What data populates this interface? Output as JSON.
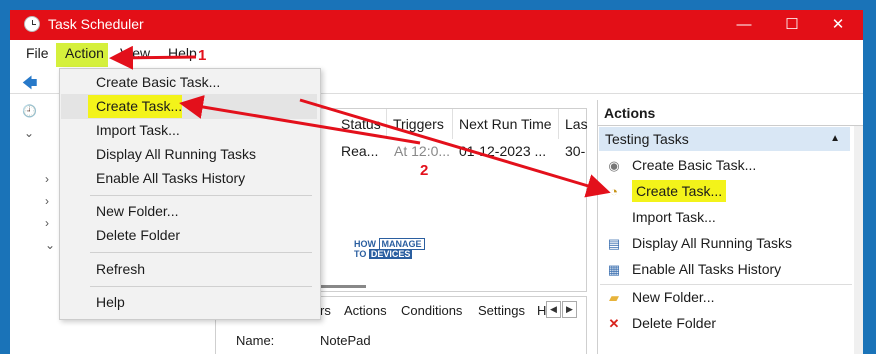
{
  "window": {
    "title": "Task Scheduler",
    "minimize": "—",
    "maximize": "☐",
    "close": "✕"
  },
  "menubar": {
    "file": "File",
    "action": "Action",
    "view": "View",
    "help": "Help"
  },
  "dropdown": {
    "items": [
      "Create Basic Task...",
      "Create Task...",
      "Import Task...",
      "Display All Running Tasks",
      "Enable All Tasks History",
      "New Folder...",
      "Delete Folder",
      "Refresh",
      "Help"
    ]
  },
  "task_list": {
    "columns": [
      "Status",
      "Triggers",
      "Next Run Time",
      "Las"
    ],
    "row": {
      "status": "Rea...",
      "triggers": "At 12:0...",
      "next_run": "01-12-2023 ...",
      "last": "30-"
    }
  },
  "watermark": {
    "line1": "HOW",
    "line2": "TO",
    "manage": "MANAGE",
    "devices": "DEVICES"
  },
  "details": {
    "tabs": [
      "rs",
      "Actions",
      "Conditions",
      "Settings",
      "H"
    ],
    "name_label": "Name:",
    "name_value": "NotePad"
  },
  "actions_pane": {
    "header": "Actions",
    "section": "Testing Tasks",
    "items": [
      {
        "label": "Create Basic Task...",
        "icon": "wizard-icon"
      },
      {
        "label": "Create Task...",
        "icon": "task-icon"
      },
      {
        "label": "Import Task...",
        "icon": "blank"
      },
      {
        "label": "Display All Running Tasks",
        "icon": "list-icon"
      },
      {
        "label": "Enable All Tasks History",
        "icon": "history-icon"
      },
      {
        "label": "New Folder...",
        "icon": "folder-icon"
      },
      {
        "label": "Delete Folder",
        "icon": "delete-icon"
      }
    ]
  },
  "annotations": {
    "step1": "1",
    "step2": "2"
  },
  "colors": {
    "titlebar": "#e30f17",
    "highlight": "#f3f31a",
    "arrow": "#e3101b",
    "section": "#d9e7f5"
  }
}
